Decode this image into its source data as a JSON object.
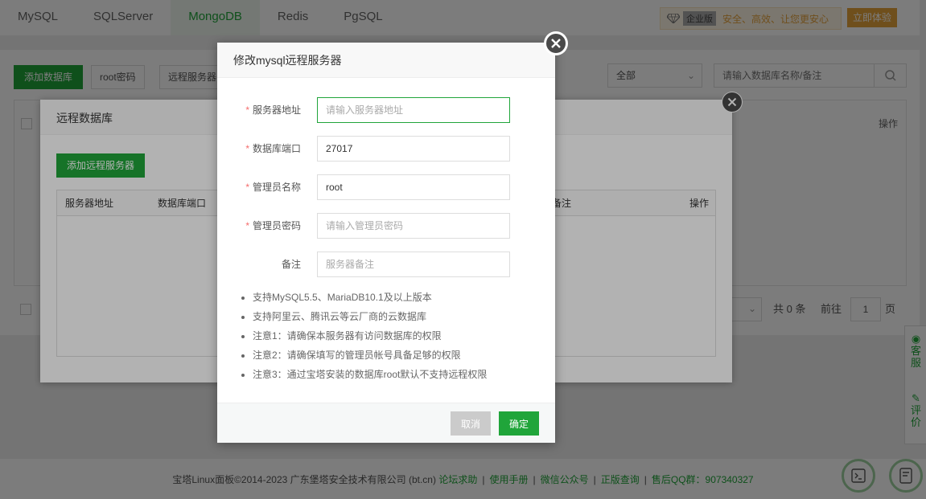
{
  "db_tabs": [
    "MySQL",
    "SQLServer",
    "MongoDB",
    "Redis",
    "PgSQL"
  ],
  "active_tab": "MongoDB",
  "enterprise": {
    "label": "企业版",
    "slogan": "安全、高效、让您更安心",
    "trial_button": "立即体验"
  },
  "toolbar": {
    "add_db": "添加数据库",
    "root_pwd": "root密码",
    "remote_server": "远程服务器",
    "filter_value": "全部",
    "search_placeholder": "请输入数据库名称/备注"
  },
  "main_table": {
    "op_header": "操作"
  },
  "pagination": {
    "total": "共 0 条",
    "goto_label": "前往",
    "page": "1",
    "unit": "页"
  },
  "remote_db_layer": {
    "title": "远程数据库",
    "add_button": "添加远程服务器",
    "columns": {
      "address": "服务器地址",
      "port": "数据库端口",
      "remark": "备注",
      "op": "操作"
    }
  },
  "dialog": {
    "title": "修改mysql远程服务器",
    "fields": {
      "address": {
        "label": "服务器地址",
        "value": "",
        "placeholder": "请输入服务器地址",
        "required": true
      },
      "port": {
        "label": "数据库端口",
        "value": "27017",
        "placeholder": "",
        "required": true
      },
      "admin_name": {
        "label": "管理员名称",
        "value": "root",
        "placeholder": "",
        "required": true
      },
      "admin_pwd": {
        "label": "管理员密码",
        "value": "",
        "placeholder": "请输入管理员密码",
        "required": true
      },
      "remark": {
        "label": "备注",
        "value": "",
        "placeholder": "服务器备注",
        "required": false
      }
    },
    "required_mark": "*",
    "notes": [
      "支持MySQL5.5、MariaDB10.1及以上版本",
      "支持阿里云、腾讯云等云厂商的云数据库",
      "注意1：请确保本服务器有访问数据库的权限",
      "注意2：请确保填写的管理员帐号具备足够的权限",
      "注意3：通过宝塔安装的数据库root默认不支持远程权限"
    ],
    "cancel": "取消",
    "confirm": "确定"
  },
  "footer": {
    "copyright": "宝塔Linux面板©2014-2023 广东堡塔安全技术有限公司 (bt.cn)",
    "links": [
      "论坛求助",
      "使用手册",
      "微信公众号",
      "正版查询"
    ],
    "qq_group": "售后QQ群：907340327"
  },
  "side_panel": {
    "service": "客服",
    "review": "评价"
  },
  "colors": {
    "primary": "#20a53a",
    "gold": "#e6a23c",
    "required": "#f56c6c"
  }
}
